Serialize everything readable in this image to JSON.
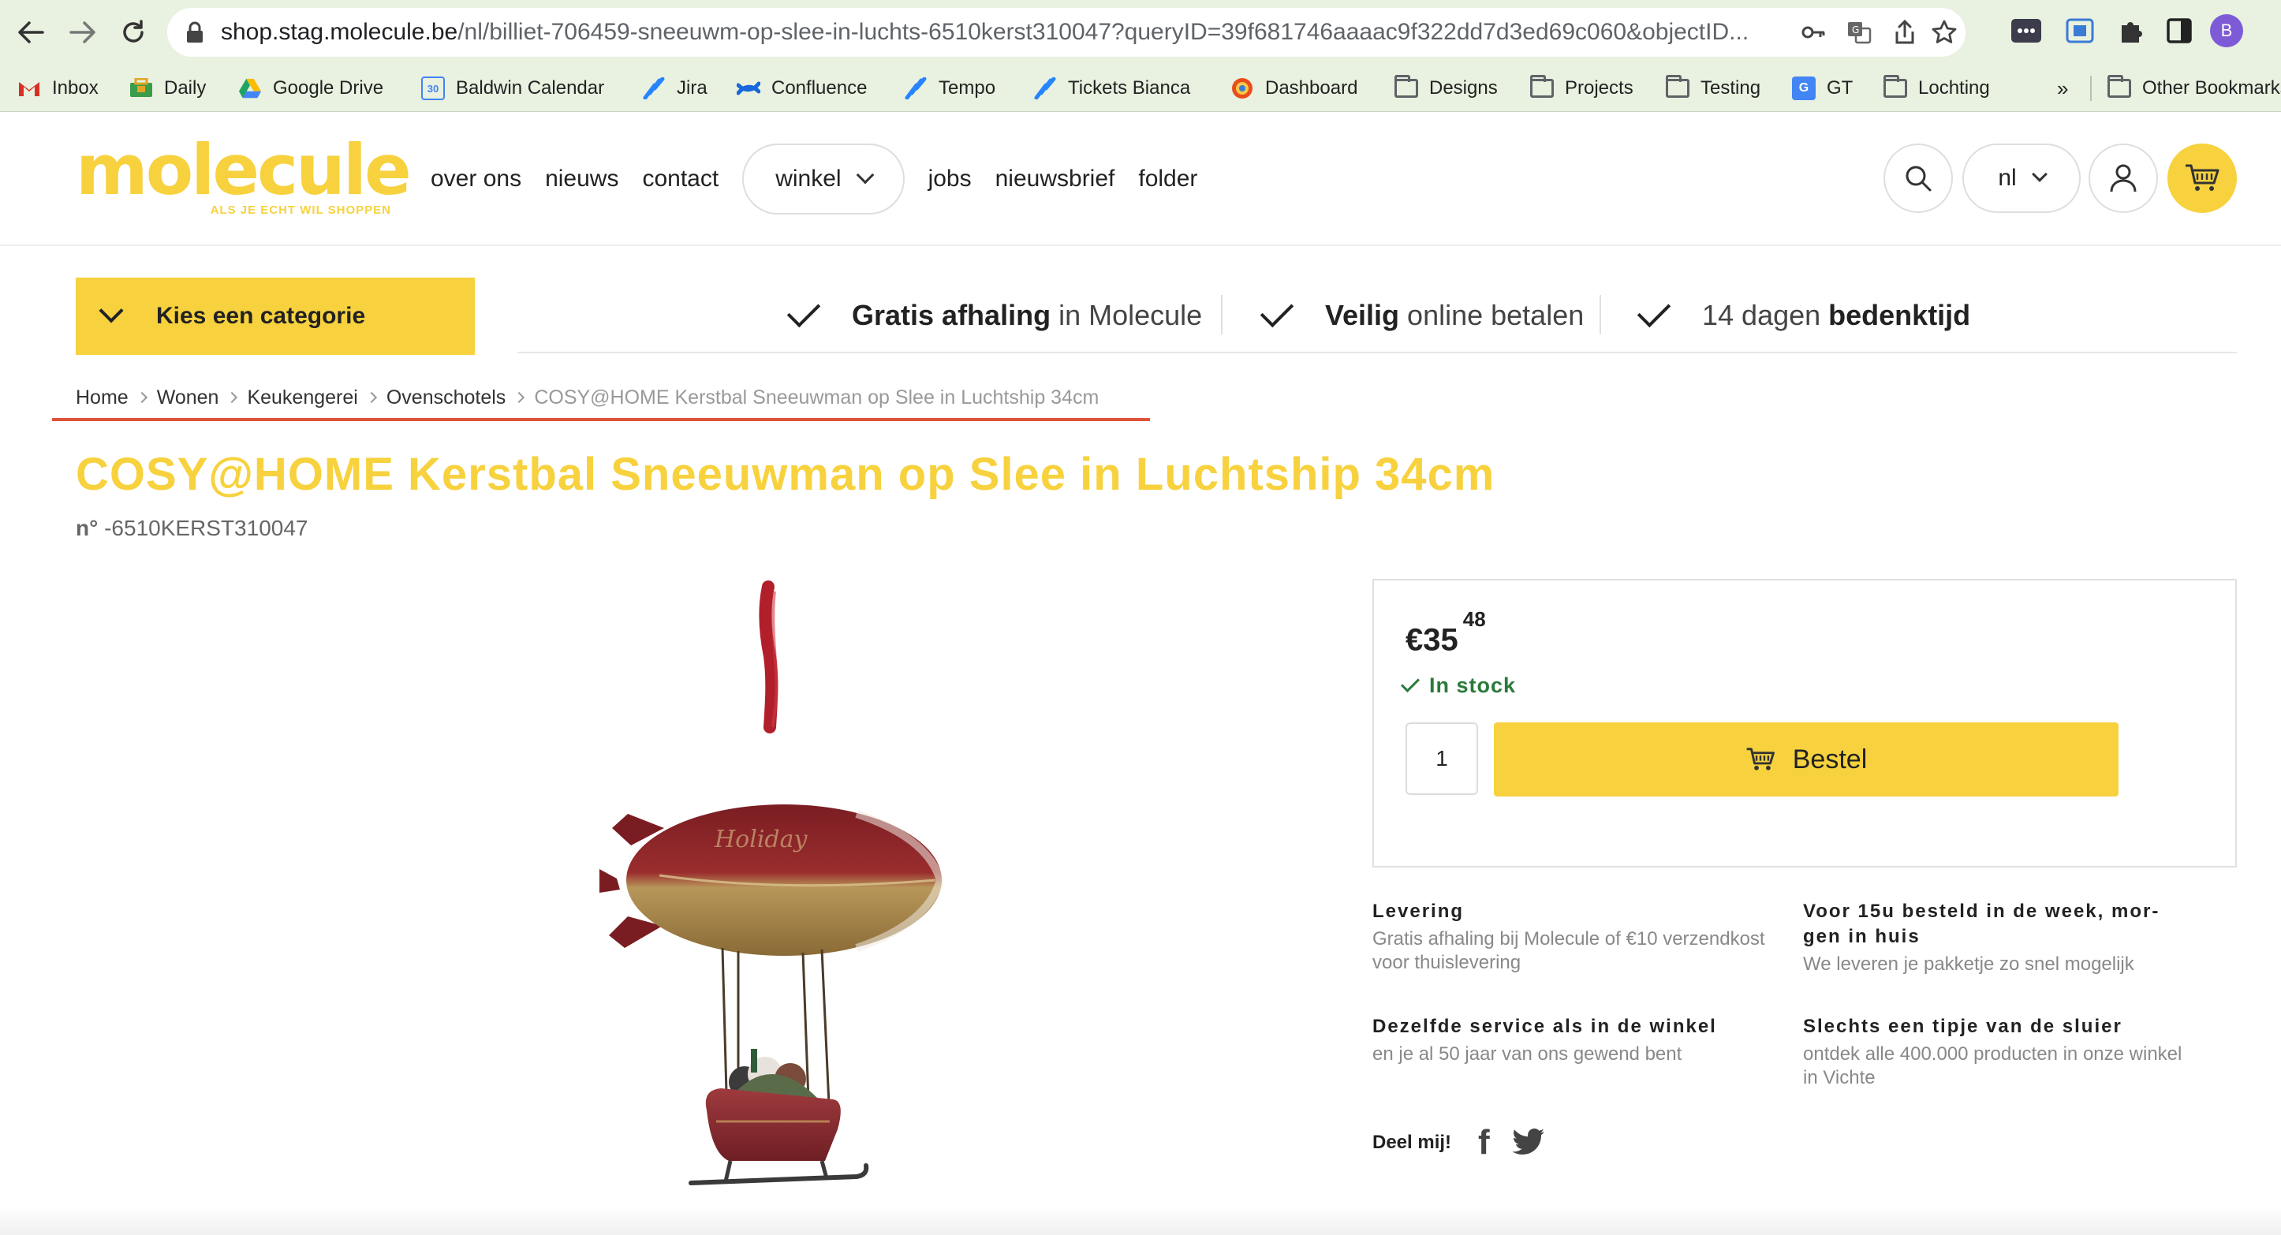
{
  "browser": {
    "url_host": "shop.stag.molecule.be",
    "url_path": "/nl/billiet-706459-sneeuwm-op-slee-in-luchts-6510kerst310047?queryID=39f681746aaaac9f322dd7d3ed69c060&objectID...",
    "profile_initial": "B",
    "bookmarks": [
      {
        "label": "Inbox"
      },
      {
        "label": "Daily"
      },
      {
        "label": "Google Drive"
      },
      {
        "label": "Baldwin Calendar"
      },
      {
        "label": "Jira"
      },
      {
        "label": "Confluence"
      },
      {
        "label": "Tempo"
      },
      {
        "label": "Tickets Bianca"
      },
      {
        "label": "Dashboard"
      },
      {
        "label": "Designs"
      },
      {
        "label": "Projects"
      },
      {
        "label": "Testing"
      },
      {
        "label": "GT"
      },
      {
        "label": "Lochting"
      },
      {
        "label": "Other Bookmarks"
      }
    ],
    "overflow_label": "»"
  },
  "site": {
    "logo_text": "molecule",
    "logo_tagline": "ALS JE ECHT WIL SHOPPEN",
    "brand_color": "#f7d23e",
    "nav": {
      "over_ons": "over ons",
      "nieuws": "nieuws",
      "contact": "contact",
      "winkel": "winkel",
      "jobs": "jobs",
      "nieuwsbrief": "nieuwsbrief",
      "folder": "folder"
    },
    "language": "nl"
  },
  "category_button": "Kies een categorie",
  "usps": [
    {
      "bold": "Gratis afhaling",
      "rest": " in Molecule"
    },
    {
      "bold": "Veilig",
      "rest": " online betalen"
    },
    {
      "pre": "14 dagen ",
      "bold": "bedenktijd"
    }
  ],
  "breadcrumb": {
    "items": [
      "Home",
      "Wonen",
      "Keukengerei",
      "Ovenschotels"
    ],
    "current": "COSY@HOME Kerstbal Sneeuwman op Slee in Luchtship 34cm"
  },
  "product": {
    "title": "COSY@HOME Kerstbal Sneeuwman op Slee in Luchtship 34cm",
    "sku_label": "n°",
    "sku": "-6510KERST310047",
    "price_main": "€35",
    "price_cents": "48",
    "stock": "In stock",
    "quantity": "1",
    "order_label": "Bestel"
  },
  "info": [
    {
      "title": "Levering",
      "text": "Gratis afhaling bij Molecule of €10 verzendkost voor thuislevering"
    },
    {
      "title": "Voor 15u besteld in de week, mor-gen in huis",
      "text": "We leveren je pakketje zo snel mogelijk"
    },
    {
      "title": "Dezelfde service als in de winkel",
      "text": "en je al 50 jaar van ons gewend bent"
    },
    {
      "title": "Slechts een tipje van de sluier",
      "text": "ontdek alle 400.000 producten in onze winkel in Vichte"
    }
  ],
  "share": {
    "label": "Deel mij!",
    "facebook_glyph": "f"
  }
}
